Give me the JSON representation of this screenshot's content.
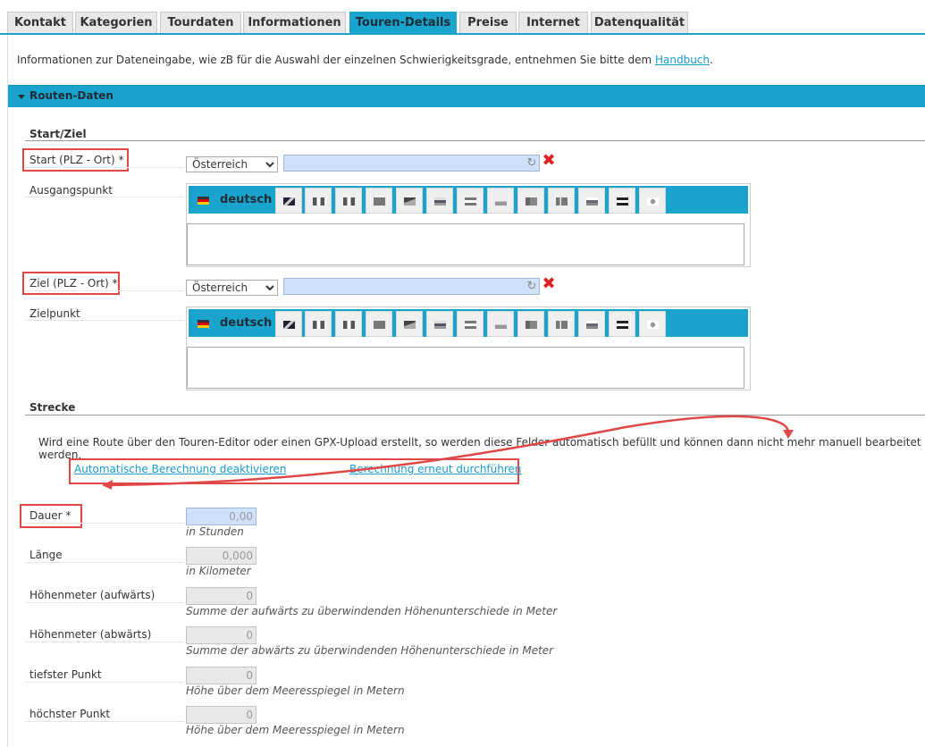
{
  "tabs": [
    {
      "label": "Kontakt"
    },
    {
      "label": "Kategorien"
    },
    {
      "label": "Tourdaten"
    },
    {
      "label": "Informationen"
    },
    {
      "label": "Touren-Details"
    },
    {
      "label": "Preise"
    },
    {
      "label": "Internet"
    },
    {
      "label": "Datenqualität"
    }
  ],
  "active_tab": "Touren-Details",
  "info": {
    "text": "Informationen zur Dateneingabe, wie zB für die Auswahl der einzelnen Schwierigkeitsgrade, entnehmen Sie bitte dem ",
    "link": "Handbuch",
    "suffix": "."
  },
  "section": {
    "title": "Routen-Daten"
  },
  "start_ziel": {
    "heading": "Start/Ziel",
    "start_label": "Start (PLZ - Ort) *",
    "start_country": "Österreich",
    "ausgangspunkt_label": "Ausgangspunkt",
    "ziel_label": "Ziel (PLZ - Ort) *",
    "ziel_country": "Österreich",
    "zielpunkt_label": "Zielpunkt",
    "active_language": "deutsch"
  },
  "strecke": {
    "heading": "Strecke",
    "note": "Wird eine Route über den Touren-Editor oder einen GPX-Upload erstellt, so werden diese Felder automatisch befüllt und können dann nicht mehr manuell bearbeitet werden.",
    "link_deactivate": "Automatische Berechnung deaktivieren",
    "link_recalc": "Berechnung erneut durchführen"
  },
  "fields": [
    {
      "label": "Dauer *",
      "value": "0,00",
      "hint": "in Stunden"
    },
    {
      "label": "Länge",
      "value": "0,000",
      "hint": "in Kilometer"
    },
    {
      "label": "Höhenmeter (aufwärts)",
      "value": "0",
      "hint": "Summe der aufwärts zu überwindenden Höhenunterschiede in Meter"
    },
    {
      "label": "Höhenmeter (abwärts)",
      "value": "0",
      "hint": "Summe der abwärts zu überwindenden Höhenunterschiede in Meter"
    },
    {
      "label": "tiefster Punkt",
      "value": "0",
      "hint": "Höhe über dem Meeresspiegel in Metern"
    },
    {
      "label": "höchster Punkt",
      "value": "0",
      "hint": "Höhe über dem Meeresspiegel in Metern"
    }
  ],
  "colors": {
    "accent": "#1aa3cc",
    "highlight": "#e04848",
    "link": "#1a9bc9"
  }
}
